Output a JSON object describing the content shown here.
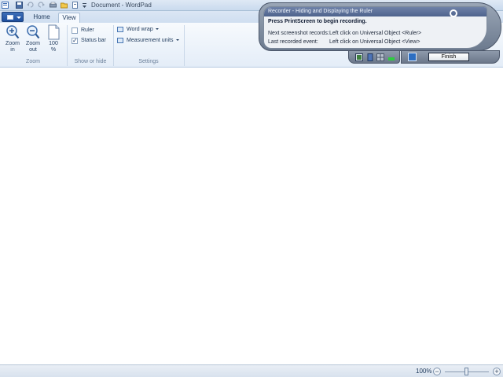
{
  "window": {
    "title": "Document - WordPad"
  },
  "quick_access": [
    {
      "icon": "app-icon"
    },
    {
      "icon": "save-icon"
    },
    {
      "icon": "undo-icon"
    },
    {
      "icon": "redo-icon"
    },
    {
      "icon": "print-icon"
    },
    {
      "icon": "open-icon"
    },
    {
      "icon": "new-icon"
    },
    {
      "icon": "customize-icon"
    }
  ],
  "tabs": {
    "home": "Home",
    "view": "View",
    "active": "View"
  },
  "ribbon": {
    "zoom_group": {
      "label": "Zoom",
      "zoom_in": "Zoom\nin",
      "zoom_out": "Zoom\nout",
      "hundred": "100\n%"
    },
    "show_hide_group": {
      "label": "Show or hide",
      "ruler": {
        "label": "Ruler",
        "checked": false
      },
      "status_bar": {
        "label": "Status bar",
        "checked": true
      }
    },
    "settings_group": {
      "label": "Settings",
      "word_wrap": "Word wrap",
      "measurement_units": "Measurement units"
    }
  },
  "statusbar": {
    "zoom_percent": "100%",
    "zoom_minus": "−",
    "zoom_plus": "+",
    "zoom_level": 1.0
  },
  "recorder": {
    "title": "Recorder - Hiding and Displaying the Ruler",
    "instruction": "Press PrintScreen to begin recording.",
    "next_label": "Next screenshot records:",
    "next_value": "Left click on Universal Object <Ruler>",
    "last_label": "Last recorded event:",
    "last_value": "Left click on Universal Object <View>",
    "finish": "Finish"
  },
  "colors": {
    "ribbon_bg": "#e4edf8",
    "recorder_frame": "#6c7a8e",
    "accent": "#1e4f9e"
  }
}
